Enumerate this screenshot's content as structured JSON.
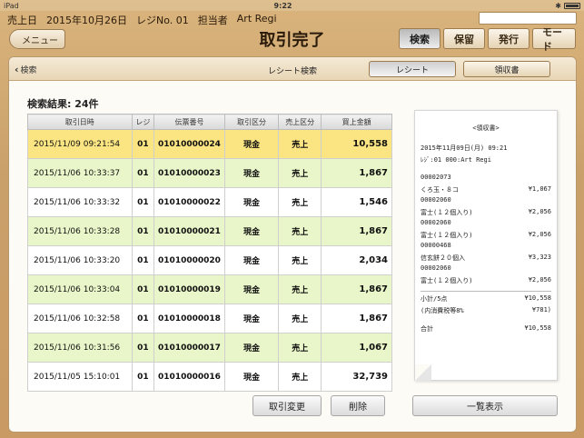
{
  "status": {
    "carrier": "iPad",
    "time": "9:22"
  },
  "header": {
    "day_label": "売上日",
    "date": "2015年10月26日",
    "register": "レジNo. 01",
    "staff_label": "担当者",
    "staff": "Art Regi",
    "menu_label": "メニュー",
    "title": "取引完了",
    "tabs": [
      "検索",
      "保留",
      "発行",
      "モード"
    ]
  },
  "panel": {
    "back_label": "検索",
    "title": "レシート検索",
    "sub_tabs": [
      "レシート",
      "領収書"
    ],
    "result_count": "検索結果: 24件"
  },
  "table": {
    "headers": [
      "取引日時",
      "レジ",
      "伝票番号",
      "取引区分",
      "売上区分",
      "買上金額"
    ],
    "rows": [
      [
        "2015/11/09 09:21:54",
        "01",
        "01010000024",
        "現金",
        "売上",
        "10,558"
      ],
      [
        "2015/11/06 10:33:37",
        "01",
        "01010000023",
        "現金",
        "売上",
        "1,867"
      ],
      [
        "2015/11/06 10:33:32",
        "01",
        "01010000022",
        "現金",
        "売上",
        "1,546"
      ],
      [
        "2015/11/06 10:33:28",
        "01",
        "01010000021",
        "現金",
        "売上",
        "1,867"
      ],
      [
        "2015/11/06 10:33:20",
        "01",
        "01010000020",
        "現金",
        "売上",
        "2,034"
      ],
      [
        "2015/11/06 10:33:04",
        "01",
        "01010000019",
        "現金",
        "売上",
        "1,867"
      ],
      [
        "2015/11/06 10:32:58",
        "01",
        "01010000018",
        "現金",
        "売上",
        "1,867"
      ],
      [
        "2015/11/06 10:31:56",
        "01",
        "01010000017",
        "現金",
        "売上",
        "1,067"
      ],
      [
        "2015/11/05 15:10:01",
        "01",
        "01010000016",
        "現金",
        "売上",
        "32,739"
      ]
    ]
  },
  "buttons": {
    "change": "取引変更",
    "delete": "削除",
    "list": "一覧表示"
  },
  "receipt": {
    "title": "<領収書>",
    "datetime": "2015年11月09日(月) 09:21",
    "register_line": "ﾚｼﾞ:01   000:Art Regi",
    "items": [
      {
        "code": "00002073",
        "name": "くろ玉・８コ",
        "price": "¥1,067"
      },
      {
        "code": "00002060",
        "name": "富士(１２個入り)",
        "price": "¥2,056"
      },
      {
        "code": "00002060",
        "name": "富士(１２個入り)",
        "price": "¥2,056"
      },
      {
        "code": "00000468",
        "name": "信玄餅２０個入",
        "price": "¥3,323"
      },
      {
        "code": "00002060",
        "name": "富士(１２個入り)",
        "price": "¥2,056"
      }
    ],
    "subtotal_label": "小計/5点",
    "subtotal": "¥10,558",
    "tax_label": "(内消費税等8%",
    "tax": "¥781)",
    "total_label": "合計",
    "total": "¥10,558"
  }
}
